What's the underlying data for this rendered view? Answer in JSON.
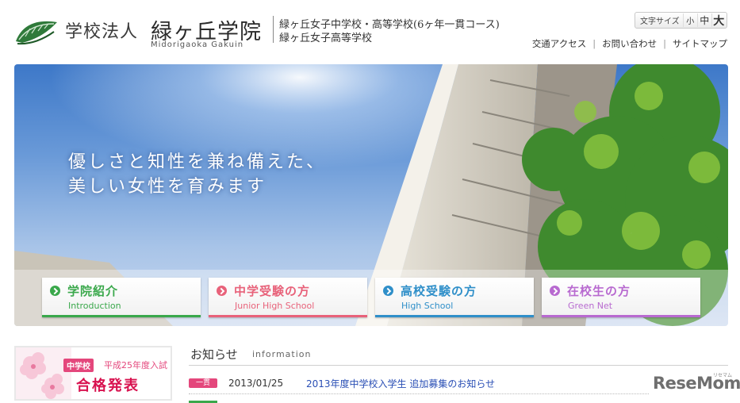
{
  "header": {
    "logo_icon": "green-leaf-crest-icon",
    "corp_label": "学校法人",
    "school_name": "緑ヶ丘学院",
    "school_name_roman": "Midorigaoka Gakuin",
    "sub_schools": [
      "緑ヶ丘女子中学校・高等学校(6ヶ年一貫コース)",
      "緑ヶ丘女子高等学校"
    ],
    "font_size": {
      "label": "文字サイズ",
      "small": "小",
      "medium": "中",
      "large": "大"
    },
    "utility_links": [
      "交通アクセス",
      "お問い合わせ",
      "サイトマップ"
    ]
  },
  "hero": {
    "copy_line1": "優しさと知性を兼ね備えた、",
    "copy_line2": "美しい女性を育みます"
  },
  "nav": [
    {
      "title": "学院紹介",
      "subtitle": "Introduction",
      "color": "#3aa84b"
    },
    {
      "title": "中学受験の方",
      "subtitle": "Junior High School",
      "color": "#e8627a"
    },
    {
      "title": "高校受験の方",
      "subtitle": "High School",
      "color": "#2f8fc9"
    },
    {
      "title": "在校生の方",
      "subtitle": "Green Net",
      "color": "#b86ad0"
    }
  ],
  "banner": {
    "badge": "中学校",
    "year_text": "平成25年度入試",
    "main_text": "合格発表"
  },
  "news": {
    "title": "お知らせ",
    "title_en": "information",
    "items": [
      {
        "tag": "一貫",
        "date": "2013/01/25",
        "text": "2013年度中学校入学生 追加募集のお知らせ"
      }
    ]
  },
  "watermark": {
    "text": "ReseMom",
    "small": "リセマム"
  },
  "colors": {
    "accent_pink": "#e4477c",
    "link_blue": "#2a4fb5",
    "green": "#3aa84b"
  }
}
